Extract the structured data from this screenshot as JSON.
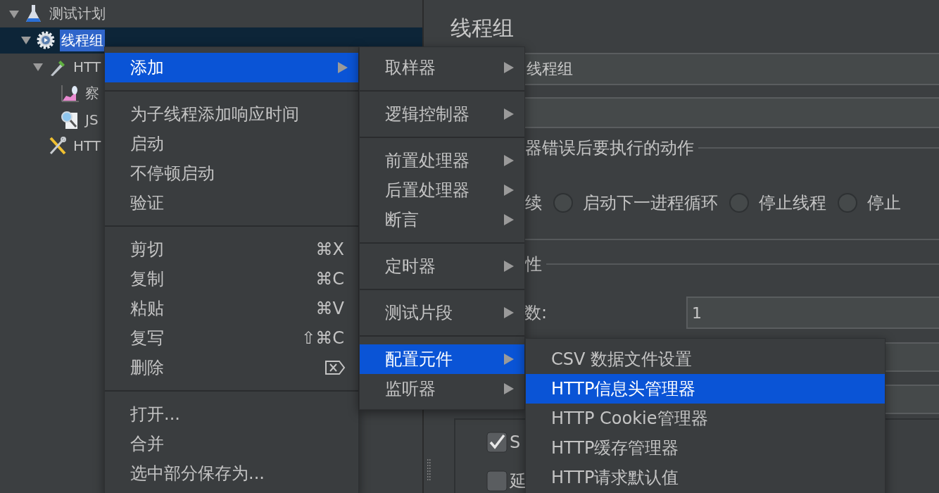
{
  "tree": [
    {
      "kind": "plan",
      "label": "测试计划",
      "selected": false,
      "expanded": true,
      "children": [
        {
          "kind": "group",
          "label": "线程组",
          "selected": true,
          "expanded": true,
          "children": [
            {
              "kind": "sampler",
              "label": "HTT",
              "selected": false,
              "expanded": true,
              "children": [
                {
                  "kind": "chart",
                  "label": "察",
                  "selected": false
                },
                {
                  "kind": "search",
                  "label": "JS",
                  "selected": false
                }
              ]
            },
            {
              "kind": "tools",
              "label": "HTT",
              "selected": false
            }
          ]
        }
      ]
    }
  ],
  "detail": {
    "title": "线程组",
    "name_value": "线程组",
    "error_group": {
      "legend": "器错误后要执行的动作",
      "lead_text": "续",
      "options": [
        {
          "label": "启动下一进程循环",
          "selected": false
        },
        {
          "label": "停止线程",
          "selected": false
        },
        {
          "label": "停止",
          "selected": false
        }
      ]
    },
    "props_group": {
      "legend": "性",
      "count_label": "数:",
      "count_value": "1"
    },
    "checkboxes": [
      {
        "label": "S",
        "checked": true
      },
      {
        "label": "延",
        "checked": false
      }
    ]
  },
  "menus": [
    {
      "items": [
        {
          "kind": "item",
          "label": "添加",
          "submenu": true,
          "selected": true
        },
        {
          "kind": "separator"
        },
        {
          "kind": "item",
          "label": "为子线程添加响应时间",
          "submenu": false,
          "selected": false
        },
        {
          "kind": "item",
          "label": "启动",
          "submenu": false,
          "selected": false
        },
        {
          "kind": "item",
          "label": "不停顿启动",
          "submenu": false,
          "selected": false
        },
        {
          "kind": "item",
          "label": "验证",
          "submenu": false,
          "selected": false
        },
        {
          "kind": "separator"
        },
        {
          "kind": "item",
          "label": "剪切",
          "shortcut": "⌘X",
          "submenu": false,
          "selected": false
        },
        {
          "kind": "item",
          "label": "复制",
          "shortcut": "⌘C",
          "submenu": false,
          "selected": false
        },
        {
          "kind": "item",
          "label": "粘贴",
          "shortcut": "⌘V",
          "submenu": false,
          "selected": false
        },
        {
          "kind": "item",
          "label": "复写",
          "shortcut": "⇧⌘C",
          "submenu": false,
          "selected": false
        },
        {
          "kind": "item",
          "label": "删除",
          "has_delete_key": true,
          "submenu": false,
          "selected": false
        },
        {
          "kind": "separator"
        },
        {
          "kind": "item",
          "label": "打开...",
          "submenu": false,
          "selected": false
        },
        {
          "kind": "item",
          "label": "合并",
          "submenu": false,
          "selected": false
        },
        {
          "kind": "item",
          "label": "选中部分保存为...",
          "submenu": false,
          "selected": false
        }
      ]
    },
    {
      "items": [
        {
          "kind": "item",
          "label": "取样器",
          "submenu": true,
          "selected": false
        },
        {
          "kind": "separator"
        },
        {
          "kind": "item",
          "label": "逻辑控制器",
          "submenu": true,
          "selected": false
        },
        {
          "kind": "separator"
        },
        {
          "kind": "item",
          "label": "前置处理器",
          "submenu": true,
          "selected": false
        },
        {
          "kind": "item",
          "label": "后置处理器",
          "submenu": true,
          "selected": false
        },
        {
          "kind": "item",
          "label": "断言",
          "submenu": true,
          "selected": false
        },
        {
          "kind": "separator"
        },
        {
          "kind": "item",
          "label": "定时器",
          "submenu": true,
          "selected": false
        },
        {
          "kind": "separator"
        },
        {
          "kind": "item",
          "label": "测试片段",
          "submenu": true,
          "selected": false
        },
        {
          "kind": "separator"
        },
        {
          "kind": "item",
          "label": "配置元件",
          "submenu": true,
          "selected": true
        },
        {
          "kind": "item",
          "label": "监听器",
          "submenu": true,
          "selected": false
        }
      ]
    },
    {
      "items": [
        {
          "kind": "item",
          "label": "CSV 数据文件设置",
          "submenu": false,
          "selected": false
        },
        {
          "kind": "item",
          "label": "HTTP信息头管理器",
          "submenu": false,
          "selected": true
        },
        {
          "kind": "item",
          "label": "HTTP Cookie管理器",
          "submenu": false,
          "selected": false
        },
        {
          "kind": "item",
          "label": "HTTP缓存管理器",
          "submenu": false,
          "selected": false
        },
        {
          "kind": "item",
          "label": "HTTP请求默认值",
          "submenu": false,
          "selected": false
        }
      ]
    }
  ]
}
